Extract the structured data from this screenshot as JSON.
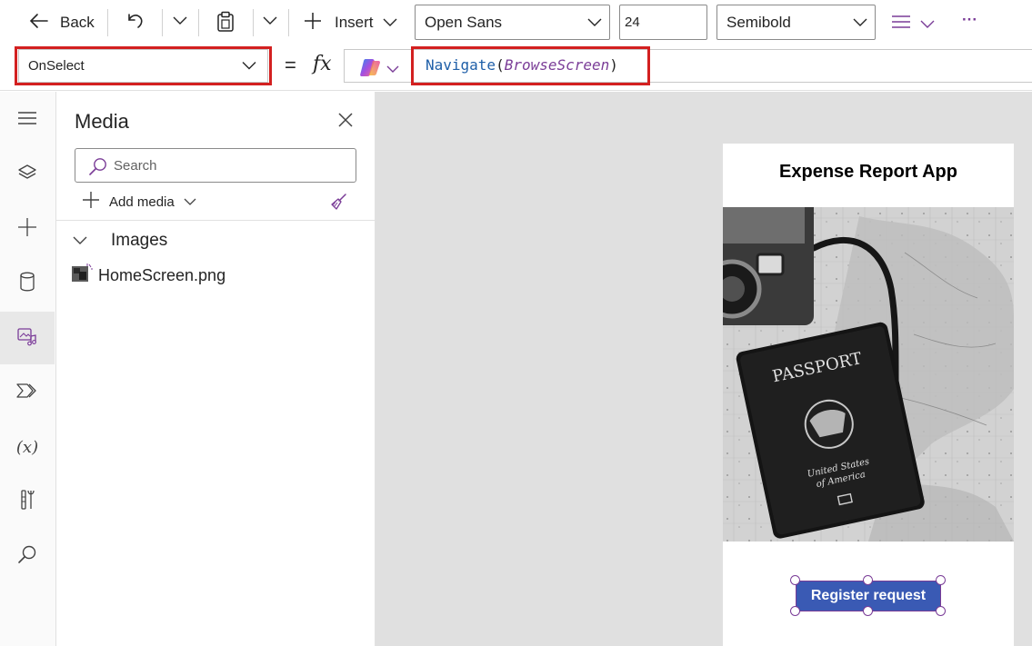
{
  "toolbar": {
    "back_label": "Back",
    "insert_label": "Insert",
    "font_family_value": "Open Sans",
    "font_size_value": "24",
    "font_weight_value": "Semibold",
    "more_label": "···"
  },
  "formula_bar": {
    "property_value": "OnSelect",
    "equals": "=",
    "fx": "fx",
    "function_name": "Navigate",
    "open_paren": "(",
    "argument": "BrowseScreen",
    "close_paren": ")"
  },
  "media_pane": {
    "title": "Media",
    "search_placeholder": "Search",
    "add_media_label": "Add media",
    "section_label": "Images",
    "files": [
      {
        "name": "HomeScreen.png"
      }
    ]
  },
  "app_screen": {
    "title": "Expense Report App",
    "button_label": "Register request",
    "image_text": {
      "passport": "PASSPORT",
      "country_line1": "United States",
      "country_line2": "of America"
    }
  },
  "colors": {
    "accent": "#7a3c97",
    "highlight_border": "#d32020",
    "button_fill": "#3a5ab4",
    "canvas_bg": "#e0e0e0"
  },
  "icons": {
    "toolbar": [
      "back-arrow-icon",
      "undo-icon",
      "chevron-down-icon",
      "paste-icon",
      "plus-icon",
      "text-align-icon"
    ],
    "rail": [
      "hamburger-icon",
      "layers-icon",
      "plus-icon",
      "database-icon",
      "media-icon",
      "power-automate-icon",
      "variables-icon",
      "tools-icon",
      "search-icon"
    ]
  }
}
